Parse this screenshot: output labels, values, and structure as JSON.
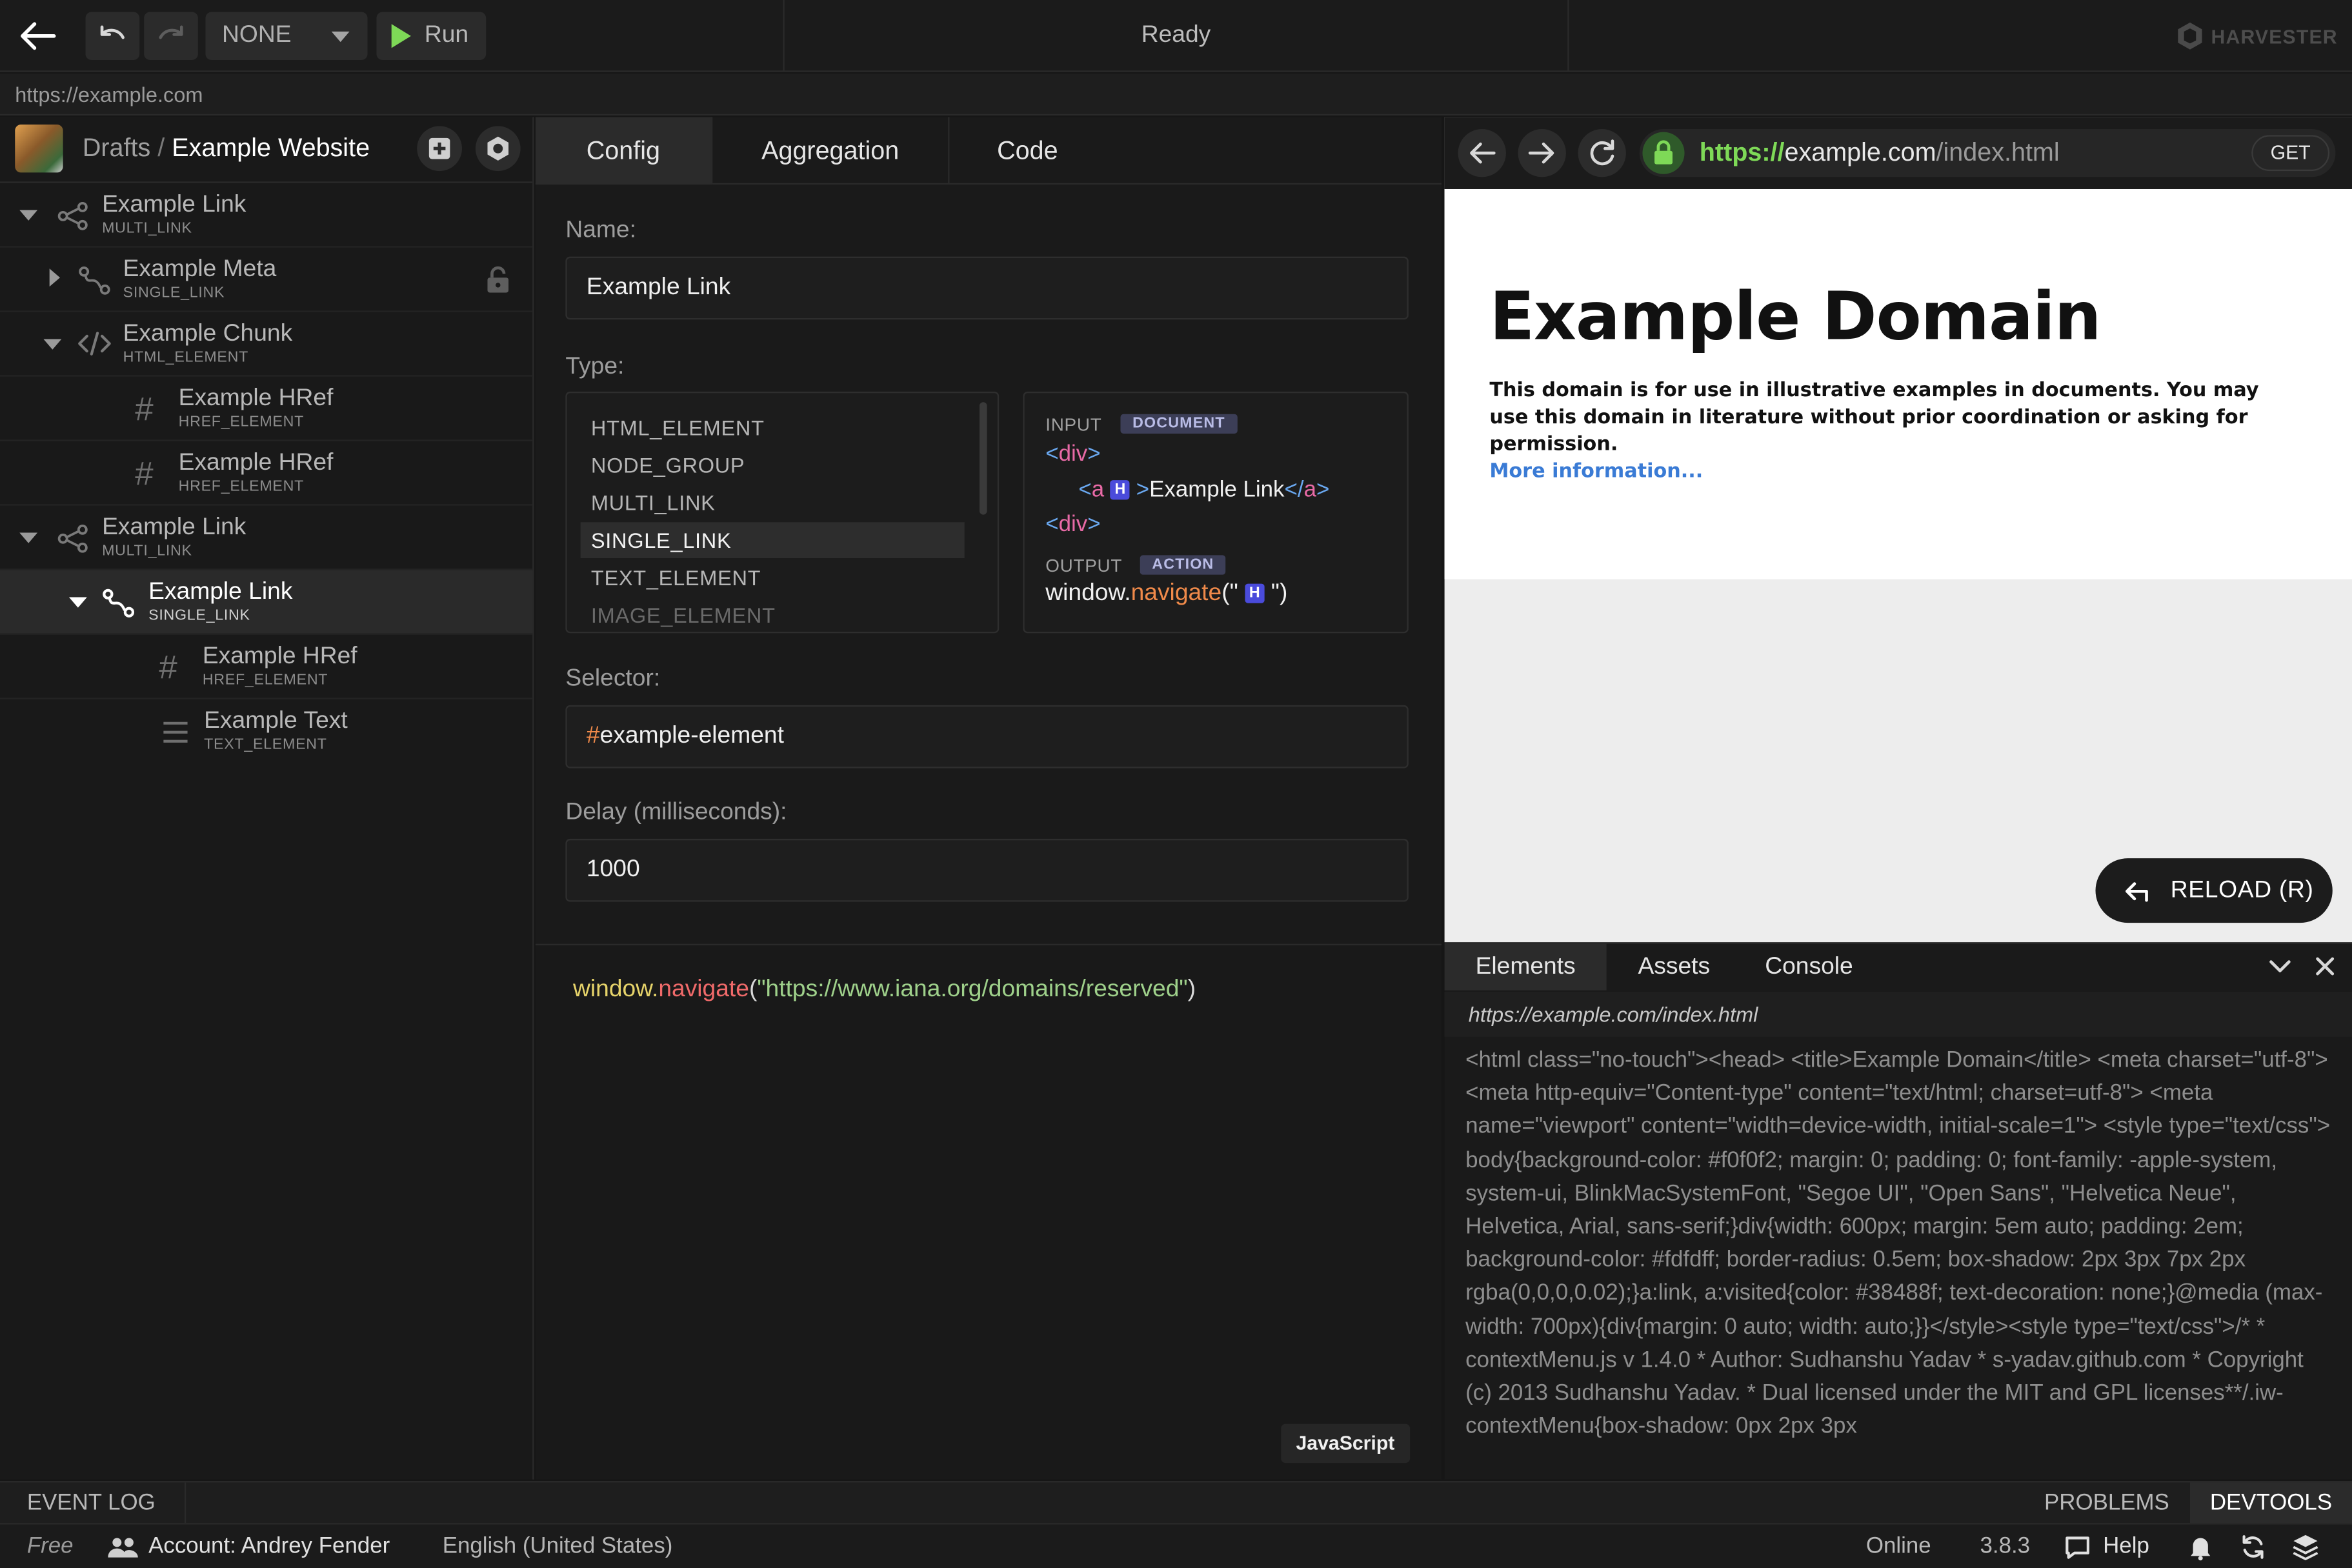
{
  "toolbar": {
    "mode_value": "NONE",
    "run_label": "Run",
    "status": "Ready",
    "brand": "HARVESTER"
  },
  "url_bar": {
    "url": "https://example.com"
  },
  "sidebar": {
    "breadcrumb_root": "Drafts",
    "breadcrumb_sep": "/",
    "breadcrumb_project": "Example Website",
    "items": [
      {
        "name": "Example Link",
        "type": "MULTI_LINK",
        "icon": "multi-link-icon",
        "expanded": true
      },
      {
        "name": "Example Meta",
        "type": "SINGLE_LINK",
        "icon": "single-link-icon",
        "expanded": false,
        "locked": true
      },
      {
        "name": "Example Chunk",
        "type": "HTML_ELEMENT",
        "icon": "code-icon",
        "expanded": true
      },
      {
        "name": "Example HRef",
        "type": "HREF_ELEMENT",
        "icon": "hash-icon"
      },
      {
        "name": "Example HRef",
        "type": "HREF_ELEMENT",
        "icon": "hash-icon"
      },
      {
        "name": "Example Link",
        "type": "MULTI_LINK",
        "icon": "multi-link-icon",
        "expanded": true
      },
      {
        "name": "Example Link",
        "type": "SINGLE_LINK",
        "icon": "single-link-icon",
        "expanded": true,
        "selected": true
      },
      {
        "name": "Example HRef",
        "type": "HREF_ELEMENT",
        "icon": "hash-icon"
      },
      {
        "name": "Example Text",
        "type": "TEXT_ELEMENT",
        "icon": "text-lines-icon"
      }
    ]
  },
  "editor": {
    "tabs": [
      "Config",
      "Aggregation",
      "Code"
    ],
    "active_tab": "Config",
    "name_label": "Name:",
    "name_value": "Example Link",
    "type_label": "Type:",
    "type_options": [
      "HTML_ELEMENT",
      "NODE_GROUP",
      "MULTI_LINK",
      "SINGLE_LINK",
      "TEXT_ELEMENT",
      "IMAGE_ELEMENT"
    ],
    "type_selected": "SINGLE_LINK",
    "preview": {
      "input_label": "INPUT",
      "input_badge": "DOCUMENT",
      "line1": "<div>",
      "line2_open": "<a",
      "h_badge": "H",
      "line2_text": "Example Link",
      "line2_close": "</a>",
      "line3": "<div>",
      "output_label": "OUTPUT",
      "output_badge": "ACTION",
      "out_obj": "window.",
      "out_fn": "navigate",
      "out_open": "(\"",
      "out_close": "\")"
    },
    "selector_label": "Selector:",
    "selector_hash": "#",
    "selector_value": "example-element",
    "delay_label": "Delay (milliseconds):",
    "delay_value": "1000",
    "code_obj": "window.",
    "code_fn": "navigate",
    "code_open": "(",
    "code_str": "\"https://www.iana.org/domains/reserved\"",
    "code_close": ")",
    "language": "JavaScript"
  },
  "browser": {
    "scheme": "https://",
    "host": "example.com",
    "path": "/index.html",
    "method": "GET",
    "page_title": "Example Domain",
    "page_text": "This domain is for use in illustrative examples in documents. You may use this domain in literature without prior coordination or asking for permission.",
    "page_link": "More information...",
    "reload_label": "RELOAD (R)"
  },
  "devtools": {
    "tabs": [
      "Elements",
      "Assets",
      "Console"
    ],
    "active_tab": "Elements",
    "url": "https://example.com/index.html",
    "source": "<html class=\"no-touch\"><head> <title>Example Domain</title> <meta charset=\"utf-8\"> <meta http-equiv=\"Content-type\" content=\"text/html; charset=utf-8\"> <meta name=\"viewport\" content=\"width=device-width, initial-scale=1\"> <style type=\"text/css\"> body{background-color: #f0f0f2; margin: 0; padding: 0; font-family: -apple-system, system-ui, BlinkMacSystemFont, \"Segoe UI\", \"Open Sans\", \"Helvetica Neue\", Helvetica, Arial, sans-serif;}div{width: 600px; margin: 5em auto; padding: 2em; background-color: #fdfdff; border-radius: 0.5em; box-shadow: 2px 3px 7px 2px rgba(0,0,0,0.02);}a:link, a:visited{color: #38488f; text-decoration: none;}@media (max-width: 700px){div{margin: 0 auto; width: auto;}}</style><style type=\"text/css\">/* * contextMenu.js v 1.4.0 * Author: Sudhanshu Yadav * s-yadav.github.com * Copyright (c) 2013 Sudhanshu Yadav. * Dual licensed under the MIT and GPL licenses**/.iw-contextMenu{box-shadow: 0px 2px 3px"
  },
  "bottom": {
    "event_log": "EVENT LOG",
    "problems": "PROBLEMS",
    "devtools": "DEVTOOLS",
    "plan": "Free",
    "account": "Account: Andrey Fender",
    "language": "English (United States)",
    "online": "Online",
    "version": "3.8.3",
    "help": "Help"
  },
  "colors": {
    "accent_green": "#7ed957",
    "code_yellow": "#e6d36a",
    "code_red": "#f06a6a",
    "code_green": "#9fd18b",
    "tag_pink": "#e86aa6",
    "bracket_blue": "#6aa8f0",
    "link_blue": "#3a7bd5",
    "badge_blue": "#4a4bdb"
  }
}
